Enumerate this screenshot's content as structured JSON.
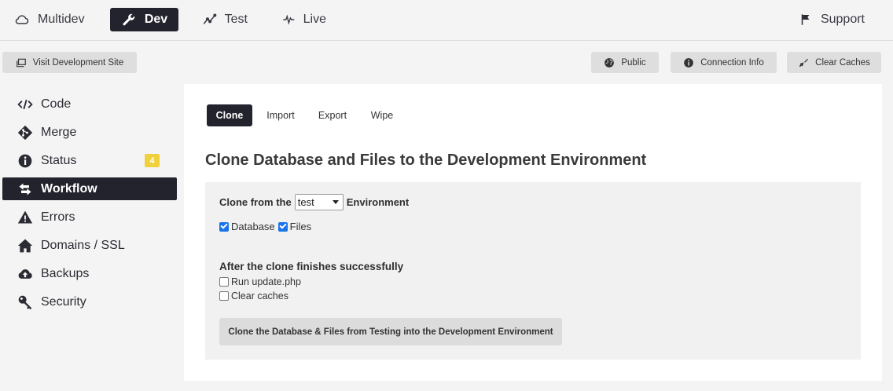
{
  "env_tabs": [
    {
      "label": "Multidev",
      "icon": "cloud-icon"
    },
    {
      "label": "Dev",
      "icon": "wrench-icon",
      "active": true
    },
    {
      "label": "Test",
      "icon": "trend-line-icon"
    },
    {
      "label": "Live",
      "icon": "pulse-icon"
    }
  ],
  "support": {
    "label": "Support",
    "icon": "flag-icon"
  },
  "actions": {
    "visit": "Visit Development Site",
    "public": "Public",
    "connection": "Connection Info",
    "clear": "Clear Caches"
  },
  "sidebar": {
    "items": [
      {
        "label": "Code",
        "icon": "code-icon"
      },
      {
        "label": "Merge",
        "icon": "git-merge-icon"
      },
      {
        "label": "Status",
        "icon": "info-icon",
        "badge": "4"
      },
      {
        "label": "Workflow",
        "icon": "workflow-arrows-icon",
        "active": true
      },
      {
        "label": "Errors",
        "icon": "warning-icon"
      },
      {
        "label": "Domains / SSL",
        "icon": "home-icon"
      },
      {
        "label": "Backups",
        "icon": "cloud-upload-icon"
      },
      {
        "label": "Security",
        "icon": "key-icon"
      }
    ]
  },
  "subtabs": [
    "Clone",
    "Import",
    "Export",
    "Wipe"
  ],
  "panel": {
    "title": "Clone Database and Files to the Development Environment",
    "clone_from_prefix": "Clone from the",
    "clone_from_value": "test",
    "clone_from_suffix": "Environment",
    "opt_database": "Database",
    "opt_files": "Files",
    "after_heading": "After the clone finishes successfully",
    "opt_update": "Run update.php",
    "opt_caches": "Clear caches",
    "cta": "Clone the Database & Files from Testing into the Development Environment"
  },
  "colors": {
    "accent_dark": "#23232d",
    "badge": "#f0d13c",
    "checkbox": "#1a73e8"
  }
}
